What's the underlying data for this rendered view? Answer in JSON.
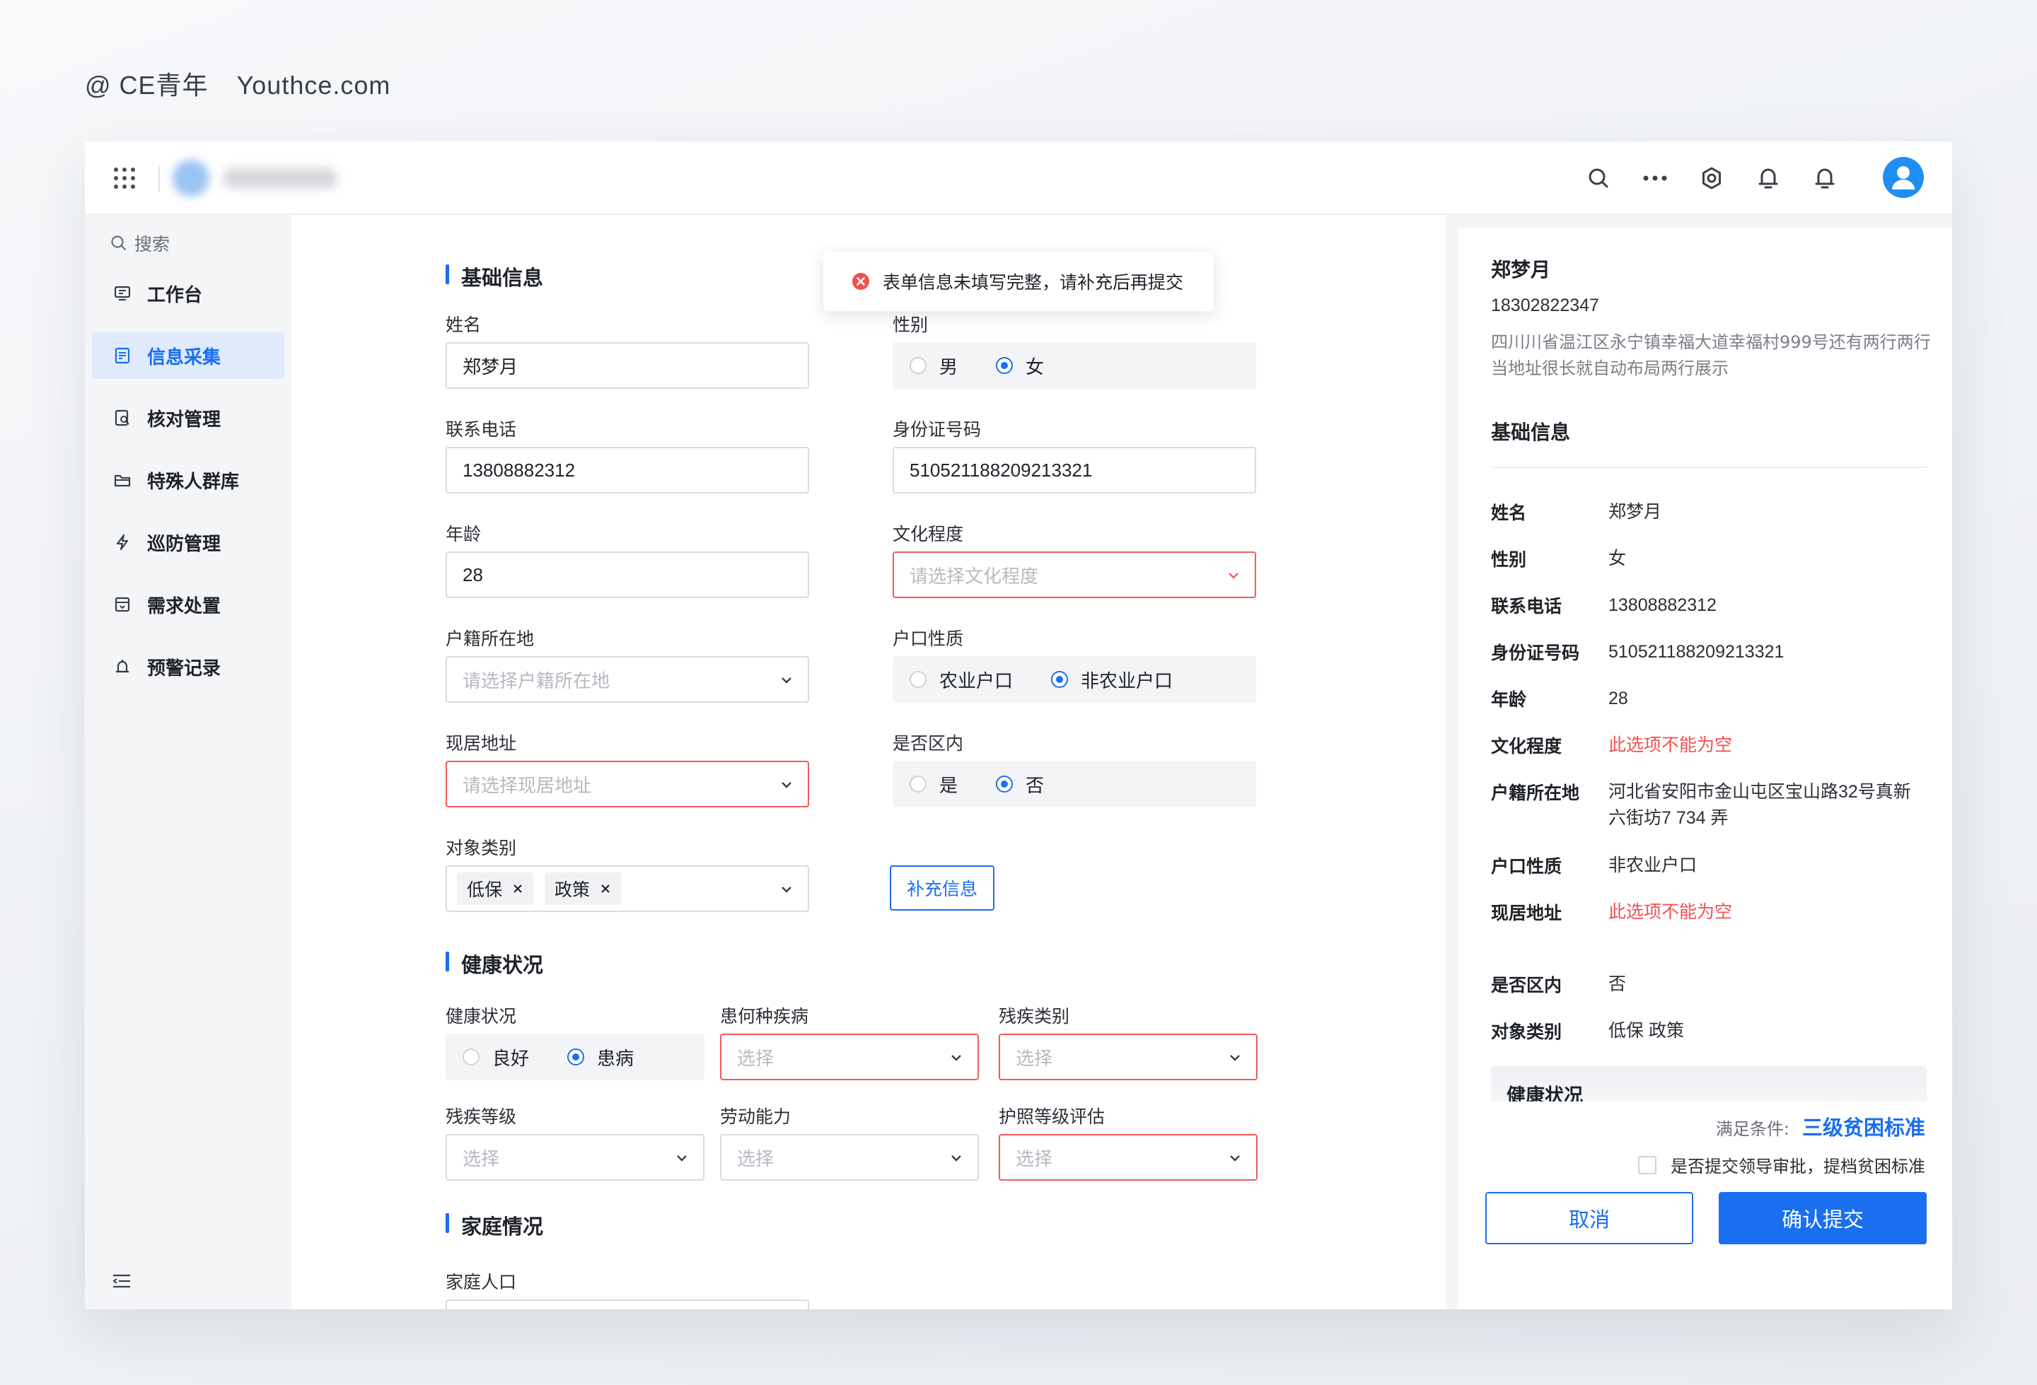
{
  "brand": {
    "at": "@ CE青年",
    "site": "Youthce.com"
  },
  "sidebar": {
    "search_label": "搜索",
    "items": [
      {
        "label": "工作台",
        "icon": "workbench-icon"
      },
      {
        "label": "信息采集",
        "icon": "info-collect-icon",
        "active": true
      },
      {
        "label": "核对管理",
        "icon": "verify-icon"
      },
      {
        "label": "特殊人群库",
        "icon": "folder-icon"
      },
      {
        "label": "巡防管理",
        "icon": "patrol-icon"
      },
      {
        "label": "需求处置",
        "icon": "demand-icon"
      },
      {
        "label": "预警记录",
        "icon": "alert-icon"
      }
    ]
  },
  "toast": {
    "message": "表单信息未填写完整，请补充后再提交"
  },
  "form": {
    "basic": {
      "title": "基础信息",
      "name_label": "姓名",
      "name_value": "郑梦月",
      "gender_label": "性别",
      "gender_options": [
        "男",
        "女"
      ],
      "gender_selected": "女",
      "phone_label": "联系电话",
      "phone_value": "13808882312",
      "id_label": "身份证号码",
      "id_value": "510521188209213321",
      "age_label": "年龄",
      "age_value": "28",
      "edu_label": "文化程度",
      "edu_placeholder": "请选择文化程度",
      "hukou_loc_label": "户籍所在地",
      "hukou_loc_placeholder": "请选择户籍所在地",
      "hukou_type_label": "户口性质",
      "hukou_type_options": [
        "农业户口",
        "非农业户口"
      ],
      "hukou_type_selected": "非农业户口",
      "addr_label": "现居地址",
      "addr_placeholder": "请选择现居地址",
      "in_district_label": "是否区内",
      "in_district_options": [
        "是",
        "否"
      ],
      "in_district_selected": "否",
      "category_label": "对象类别",
      "category_tags": [
        "低保",
        "政策"
      ],
      "supplement_button": "补充信息"
    },
    "health": {
      "title": "健康状况",
      "status_label": "健康状况",
      "status_options": [
        "良好",
        "患病"
      ],
      "status_selected": "患病",
      "disease_label": "患何种疾病",
      "disease_placeholder": "选择",
      "disability_type_label": "残疾类别",
      "disability_type_placeholder": "选择",
      "disability_level_label": "残疾等级",
      "disability_level_placeholder": "选择",
      "labor_label": "劳动能力",
      "labor_placeholder": "选择",
      "care_label": "护照等级评估",
      "care_placeholder": "选择"
    },
    "family": {
      "title": "家庭情况",
      "population_label": "家庭人口"
    }
  },
  "panel": {
    "name": "郑梦月",
    "phone": "18302822347",
    "address": "四川川省温江区永宁镇幸福大道幸福村999号还有两行两行当地址很长就自动布局两行展示",
    "section_title": "基础信息",
    "rows": [
      {
        "k": "姓名",
        "v": "郑梦月"
      },
      {
        "k": "性别",
        "v": "女"
      },
      {
        "k": "联系电话",
        "v": "13808882312"
      },
      {
        "k": "身份证号码",
        "v": "510521188209213321"
      },
      {
        "k": "年龄",
        "v": "28"
      },
      {
        "k": "文化程度",
        "v": "此选项不能为空",
        "error": true
      },
      {
        "k": "户籍所在地",
        "v": "河北省安阳市金山屯区宝山路32号真新六街坊7 734 弄"
      },
      {
        "k": "户口性质",
        "v": "非农业户口"
      },
      {
        "k": "现居地址",
        "v": "此选项不能为空",
        "error": true
      },
      {
        "k": "是否区内",
        "v": "否"
      },
      {
        "k": "对象类别",
        "v": "低保 政策"
      }
    ],
    "health_title": "健康状况",
    "condition_label": "满足条件:",
    "condition_value": "三级贫困标准",
    "approve_label": "是否提交领导审批，提档贫困标准",
    "cancel_button": "取消",
    "submit_button": "确认提交"
  },
  "colors": {
    "primary": "#1a6ef0",
    "error": "#f25b5b",
    "active_nav_bg": "#dfeafd"
  }
}
